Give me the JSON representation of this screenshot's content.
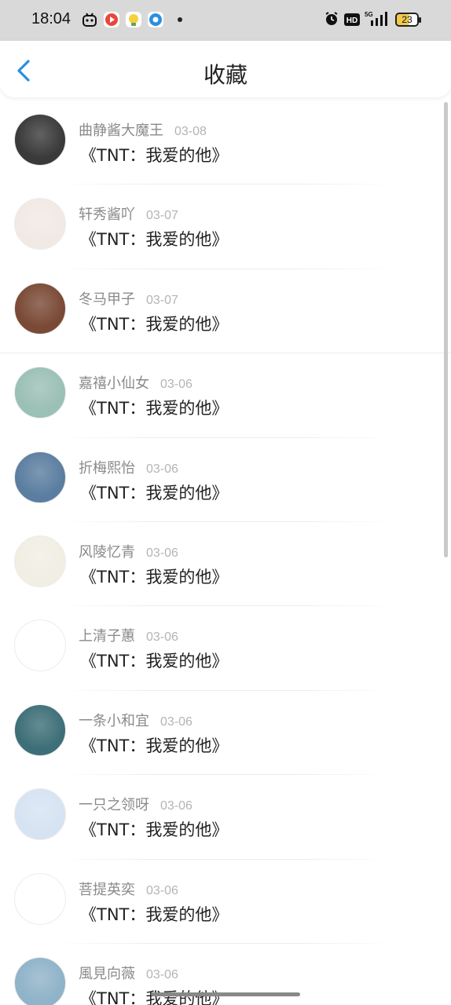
{
  "status_bar": {
    "time": "18:04",
    "battery": "23",
    "icons": [
      "app-notification-icon",
      "video-app-icon",
      "bulb-app-icon",
      "browser-app-icon",
      "alarm-icon",
      "hd-icon",
      "5g-signal-icon",
      "battery-icon"
    ]
  },
  "header": {
    "title": "收藏",
    "back_icon": "chevron-left-icon"
  },
  "favorites": [
    {
      "name": "曲静酱大魔王",
      "date": "03-08",
      "title": "《TNT：我爱的他》",
      "avatar_color": "#3a3a3a"
    },
    {
      "name": "轩秀酱吖",
      "date": "03-07",
      "title": "《TNT：我爱的他》",
      "avatar_color": "#f1e9e4"
    },
    {
      "name": "冬马甲子",
      "date": "03-07",
      "title": "《TNT：我爱的他》",
      "avatar_color": "#7a4a36"
    },
    {
      "name": "嘉禧小仙女",
      "date": "03-06",
      "title": "《TNT：我爱的他》",
      "avatar_color": "#9bc0b5"
    },
    {
      "name": "折梅熙怡",
      "date": "03-06",
      "title": "《TNT：我爱的他》",
      "avatar_color": "#5b7ea0"
    },
    {
      "name": "风陵忆青",
      "date": "03-06",
      "title": "《TNT：我爱的他》",
      "avatar_color": "#f1eee4"
    },
    {
      "name": "上清子蕙",
      "date": "03-06",
      "title": "《TNT：我爱的他》",
      "avatar_color": "#ffffff"
    },
    {
      "name": "一条小和宜",
      "date": "03-06",
      "title": "《TNT：我爱的他》",
      "avatar_color": "#3e6f78"
    },
    {
      "name": "一只之领呀",
      "date": "03-06",
      "title": "《TNT：我爱的他》",
      "avatar_color": "#d6e3f2"
    },
    {
      "name": "菩提英奕",
      "date": "03-06",
      "title": "《TNT：我爱的他》",
      "avatar_color": "#ffffff"
    },
    {
      "name": "風見向薇",
      "date": "03-06",
      "title": "《TNT：我爱的他》",
      "avatar_color": "#8fb3c8"
    }
  ],
  "colors": {
    "accent": "#2a8fe0",
    "name_text": "#8a8a8a",
    "date_text": "#b4b4b4"
  }
}
